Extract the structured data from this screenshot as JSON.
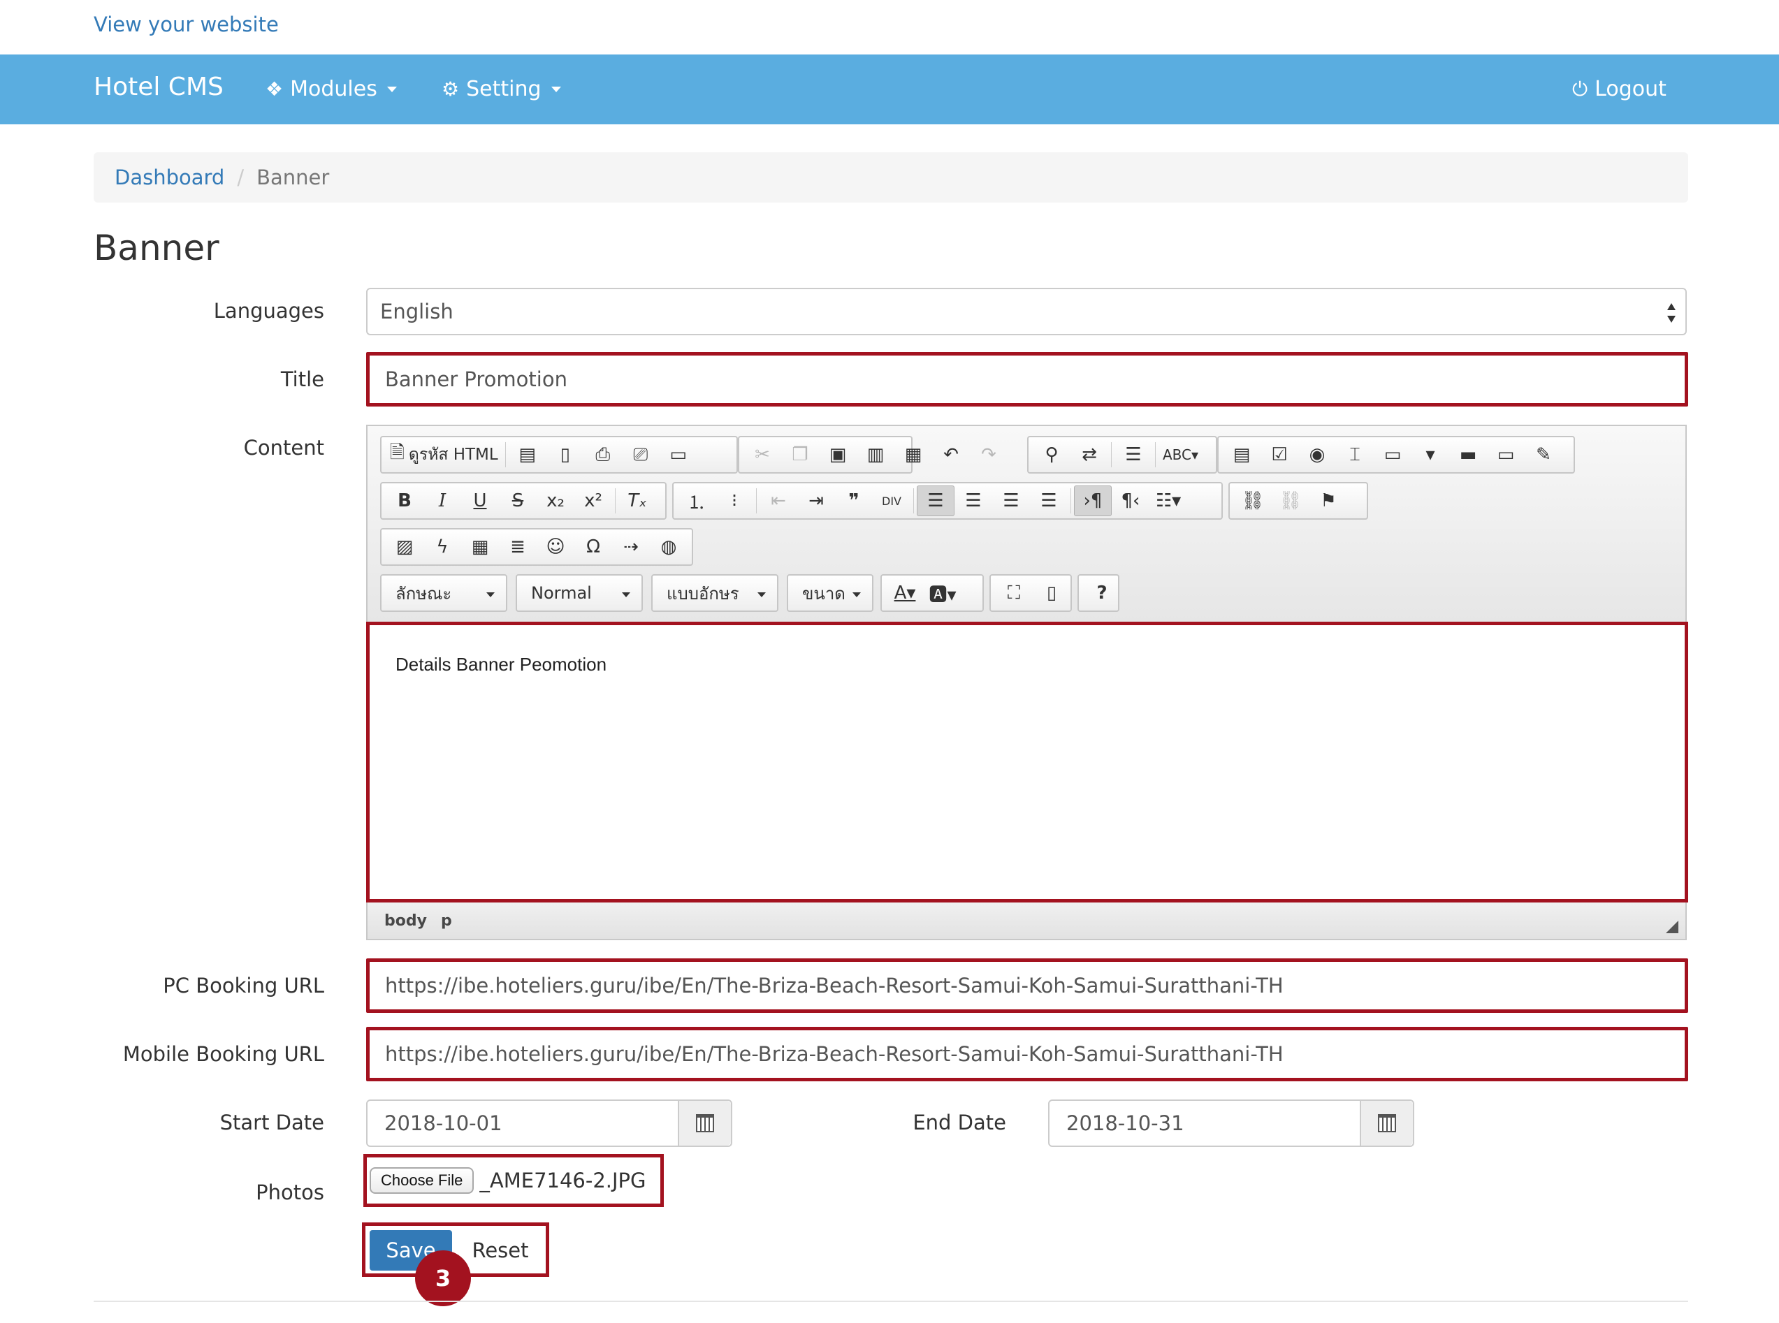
{
  "top_link": "View your website",
  "navbar": {
    "brand": "Hotel CMS",
    "modules": {
      "label": "Modules",
      "icon": "cubes-icon"
    },
    "setting": {
      "label": "Setting",
      "icon": "cogs-icon"
    },
    "logout": {
      "label": "Logout",
      "icon": "power-icon"
    }
  },
  "breadcrumb": {
    "home": "Dashboard",
    "current": "Banner"
  },
  "page_title": "Banner",
  "form": {
    "languages": {
      "label": "Languages",
      "value": "English"
    },
    "title": {
      "label": "Title",
      "value": "Banner Promotion"
    },
    "content": {
      "label": "Content",
      "source_button": "ดูรหัส HTML",
      "style_combo": "ลักษณะ",
      "format_combo": "Normal",
      "font_combo": "แบบอักษร",
      "size_combo": "ขนาด",
      "body_text": "Details Banner Peomotion",
      "path": [
        "body",
        "p"
      ]
    },
    "pc_booking_url": {
      "label": "PC Booking URL",
      "value": "https://ibe.hoteliers.guru/ibe/En/The-Briza-Beach-Resort-Samui-Koh-Samui-Suratthani-TH"
    },
    "mobile_booking_url": {
      "label": "Mobile Booking URL",
      "value": "https://ibe.hoteliers.guru/ibe/En/The-Briza-Beach-Resort-Samui-Koh-Samui-Suratthani-TH"
    },
    "start_date": {
      "label": "Start Date",
      "value": "2018-10-01"
    },
    "end_date": {
      "label": "End Date",
      "value": "2018-10-31"
    },
    "photos": {
      "label": "Photos",
      "button": "Choose File",
      "file": "_AME7146-2.JPG"
    }
  },
  "actions": {
    "save": "Save",
    "reset": "Reset"
  },
  "step_badge": "3",
  "colors": {
    "navbar": "#5aade0",
    "link": "#337ab7",
    "highlight": "#a3121f",
    "primary": "#337ab7"
  }
}
